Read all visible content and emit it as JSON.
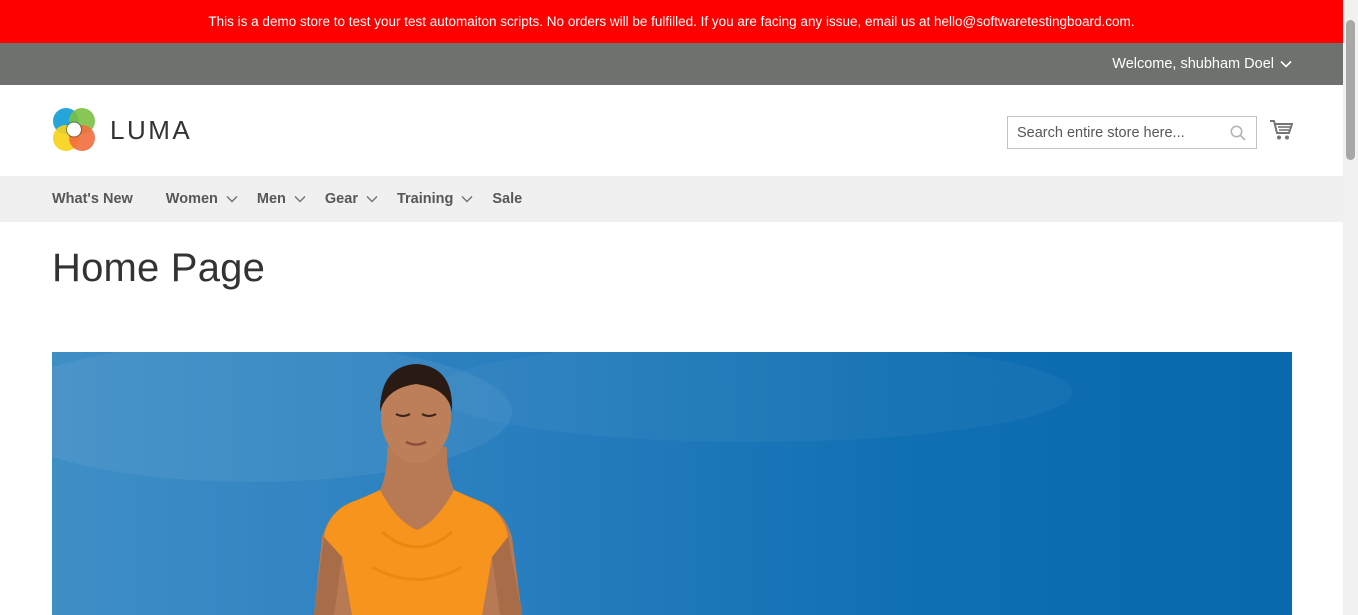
{
  "demo_banner": {
    "text": "This is a demo store to test your test automaiton scripts. No orders will be fulfilled. If you are facing any issue, email us at hello@softwaretestingboard.com."
  },
  "header": {
    "welcome_text": "Welcome, shubham Doel"
  },
  "logo": {
    "text": "LUMA"
  },
  "search": {
    "placeholder": "Search entire store here..."
  },
  "nav": {
    "items": [
      {
        "label": "What's New",
        "has_dropdown": false
      },
      {
        "label": "Women",
        "has_dropdown": true
      },
      {
        "label": "Men",
        "has_dropdown": true
      },
      {
        "label": "Gear",
        "has_dropdown": true
      },
      {
        "label": "Training",
        "has_dropdown": true
      },
      {
        "label": "Sale",
        "has_dropdown": false
      }
    ]
  },
  "page": {
    "title": "Home Page"
  },
  "hero": {
    "image": "yoga-woman-orange-shirt-blue-sky"
  },
  "colors": {
    "banner_bg": "#ff0000",
    "panel_bg": "#6e716e",
    "nav_bg": "#f0f0f0",
    "hero_sky": "#1a75b8"
  }
}
